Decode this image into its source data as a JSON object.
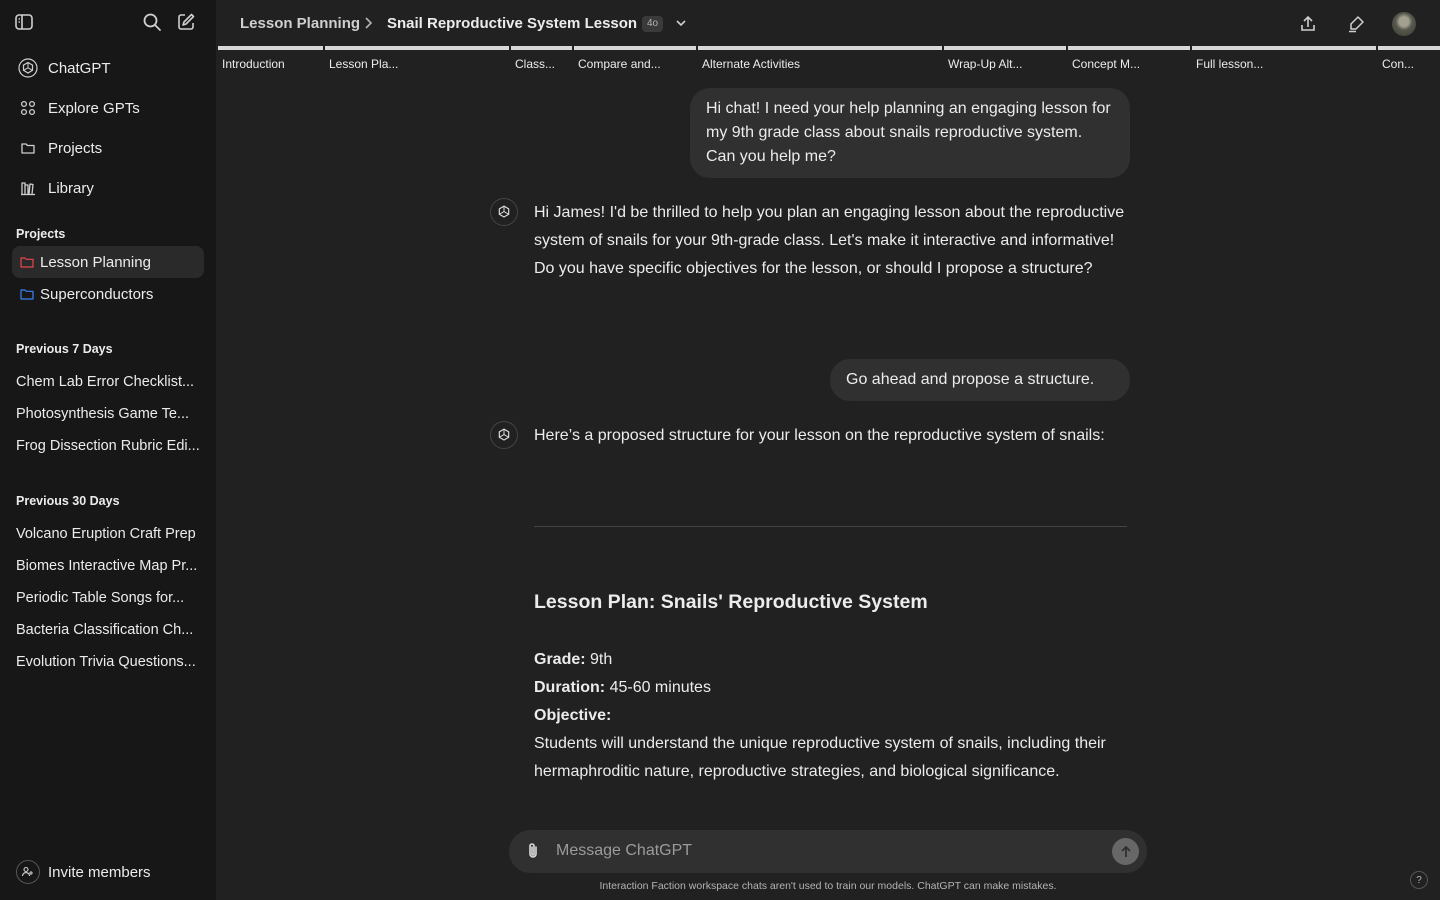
{
  "sidebar": {
    "nav": [
      {
        "label": "ChatGPT",
        "icon": "chatgpt-logo-icon"
      },
      {
        "label": "Explore GPTs",
        "icon": "grid-icon"
      },
      {
        "label": "Projects",
        "icon": "folder-icon"
      },
      {
        "label": "Library",
        "icon": "library-icon"
      }
    ],
    "projects_label": "Projects",
    "projects": [
      {
        "label": "Lesson Planning",
        "active": true,
        "color": "#e5484d"
      },
      {
        "label": "Superconductors",
        "active": false,
        "color": "#3b82f6"
      }
    ],
    "prev7_label": "Previous 7 Days",
    "prev7": [
      "Chem Lab Error Checklist...",
      "Photosynthesis Game Te...",
      "Frog Dissection Rubric Edi..."
    ],
    "prev30_label": "Previous 30 Days",
    "prev30": [
      "Volcano Eruption Craft Prep",
      "Biomes Interactive Map Pr...",
      "Periodic Table Songs for...",
      "Bacteria Classification Ch...",
      "Evolution Trivia Questions..."
    ],
    "invite_label": "Invite members"
  },
  "header": {
    "crumb1": "Lesson Planning",
    "crumb2": "Snail Reproductive System Lesson",
    "model": "4o"
  },
  "tabs": [
    "Introduction",
    "Lesson Pla...",
    "Class...",
    "Compare and...",
    "Alternate Activities",
    "Wrap-Up Alt...",
    "Concept M...",
    "Full lesson...",
    "Con..."
  ],
  "messages": {
    "user1": "Hi chat! I need your help planning an engaging lesson for my 9th grade class about snails reproductive system. Can you help me?",
    "gpt1": "Hi James! I'd be thrilled to help you plan an engaging lesson about the reproductive system of snails for your 9th-grade class. Let's make it interactive and informative! Do you have specific objectives for the lesson, or should I propose a structure?",
    "user2": "Go ahead and propose a structure.",
    "gpt2": "Here’s a proposed structure for your lesson on the reproductive system of snails:",
    "lesson_title": "Lesson Plan: Snails' Reproductive System",
    "grade_label": "Grade:",
    "grade_value": "9th",
    "duration_label": "Duration:",
    "duration_value": "45-60 minutes",
    "objective_label": "Objective:",
    "objective_text": "Students will understand the unique reproductive system of snails, including their hermaphroditic nature, reproductive strategies, and biological significance."
  },
  "composer": {
    "placeholder": "Message ChatGPT"
  },
  "disclaimer": "Interaction Faction workspace chats aren't used to train our models. ChatGPT can make mistakes.",
  "help": "?"
}
